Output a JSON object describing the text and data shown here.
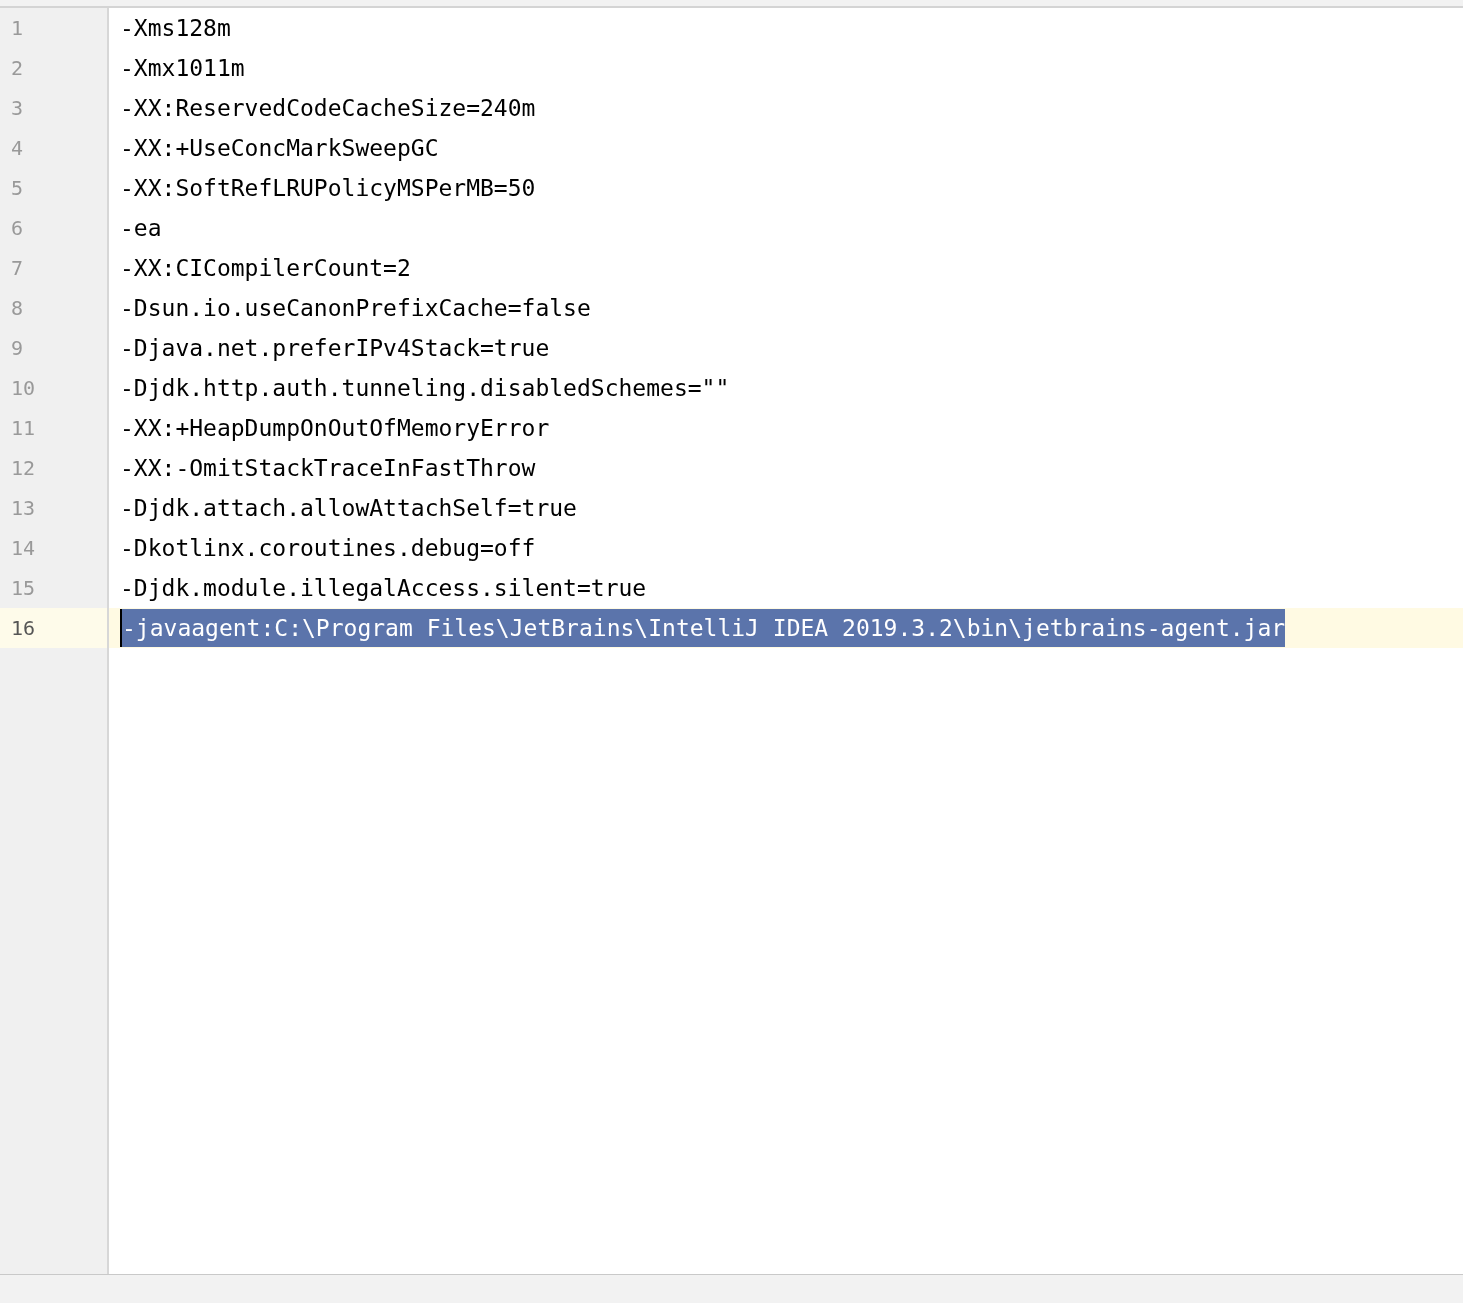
{
  "editor": {
    "lines": [
      {
        "number": "1",
        "text": "-Xms128m",
        "selected": false
      },
      {
        "number": "2",
        "text": "-Xmx1011m",
        "selected": false
      },
      {
        "number": "3",
        "text": "-XX:ReservedCodeCacheSize=240m",
        "selected": false
      },
      {
        "number": "4",
        "text": "-XX:+UseConcMarkSweepGC",
        "selected": false
      },
      {
        "number": "5",
        "text": "-XX:SoftRefLRUPolicyMSPerMB=50",
        "selected": false
      },
      {
        "number": "6",
        "text": "-ea",
        "selected": false
      },
      {
        "number": "7",
        "text": "-XX:CICompilerCount=2",
        "selected": false
      },
      {
        "number": "8",
        "text": "-Dsun.io.useCanonPrefixCache=false",
        "selected": false
      },
      {
        "number": "9",
        "text": "-Djava.net.preferIPv4Stack=true",
        "selected": false
      },
      {
        "number": "10",
        "text": "-Djdk.http.auth.tunneling.disabledSchemes=\"\"",
        "selected": false
      },
      {
        "number": "11",
        "text": "-XX:+HeapDumpOnOutOfMemoryError",
        "selected": false
      },
      {
        "number": "12",
        "text": "-XX:-OmitStackTraceInFastThrow",
        "selected": false
      },
      {
        "number": "13",
        "text": "-Djdk.attach.allowAttachSelf=true",
        "selected": false
      },
      {
        "number": "14",
        "text": "-Dkotlinx.coroutines.debug=off",
        "selected": false
      },
      {
        "number": "15",
        "text": "-Djdk.module.illegalAccess.silent=true",
        "selected": false
      },
      {
        "number": "16",
        "text": "-javaagent:C:\\Program Files\\JetBrains\\IntelliJ IDEA 2019.3.2\\bin\\jetbrains-agent.jar",
        "selected": true
      }
    ]
  }
}
